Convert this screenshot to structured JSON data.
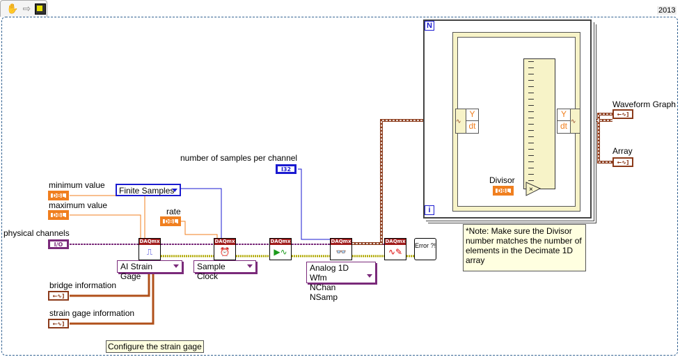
{
  "toolbar": {
    "icons": [
      "hand-tool-icon",
      "step-arrow-icon",
      "highlight-execution-icon"
    ],
    "version": "2013"
  },
  "labels": {
    "samples_per_channel": "number of samples per channel",
    "min": "minimum value",
    "max": "maximum value",
    "rate": "rate",
    "physical_channels": "physical channels",
    "bridge": "bridge information",
    "strain": "strain gage information",
    "divisor": "Divisor",
    "waveform_graph": "Waveform Graph",
    "array": "Array"
  },
  "terminals": {
    "dbl": "DBL",
    "i32": "I32",
    "io": "I/O",
    "cluster": "←∿]"
  },
  "rings": {
    "sample_mode": "Finite Samples",
    "channel_type": "AI Strain Gage",
    "timing": "Sample Clock",
    "read_line1": "Analog 1D Wfm",
    "read_line2": "NChan NSamp"
  },
  "nodes": {
    "header": "DAQmx",
    "error": "Error ?!"
  },
  "loop": {
    "count": "N",
    "iteration": "i",
    "unbundle_y": "Y",
    "unbundle_dt": "dt",
    "multiply": "×"
  },
  "note": "*Note: Make sure the Divisor number matches the number of elements in the Decimate 1D array",
  "comment": "Configure the strain gage",
  "colors": {
    "dbl": "#f07f1f",
    "integer": "#1a1ad0",
    "task": "#7a2a7a",
    "error": "#c8c800",
    "waveform": "#8b3a1a"
  }
}
